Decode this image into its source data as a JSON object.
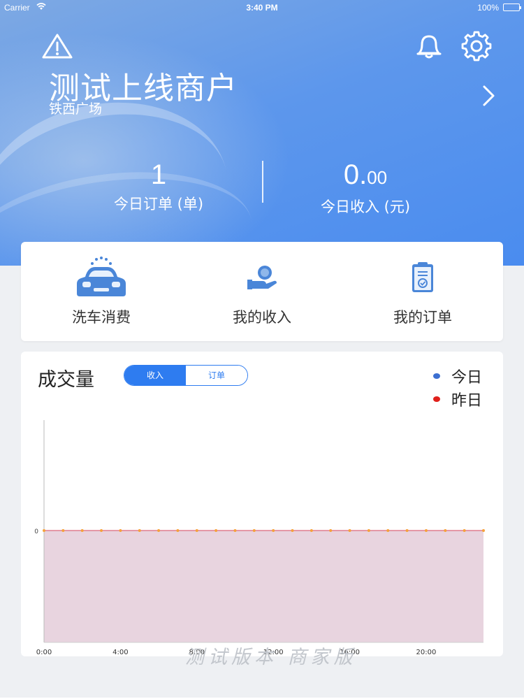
{
  "status_bar": {
    "carrier": "Carrier",
    "time": "3:40 PM",
    "battery": "100%"
  },
  "header": {
    "merchant_name": "测试上线商户",
    "location": "铁西广场",
    "icons": [
      "warning-icon",
      "bell-icon",
      "gear-icon",
      "chevron-right-icon"
    ],
    "background_color": "#4a8cef"
  },
  "stats": {
    "orders": {
      "value": "1",
      "label": "今日订单 (单)"
    },
    "income": {
      "value_int": "0.",
      "value_dec": "00",
      "label": "今日收入 (元)"
    }
  },
  "menu": {
    "items": [
      {
        "label": "洗车消费",
        "icon": "car-wash-icon"
      },
      {
        "label": "我的收入",
        "icon": "income-icon"
      },
      {
        "label": "我的订单",
        "icon": "order-clipboard-icon"
      }
    ]
  },
  "chart_card": {
    "title": "成交量",
    "tabs": [
      {
        "label": "收入",
        "active": true
      },
      {
        "label": "订单",
        "active": false
      }
    ],
    "legend": [
      {
        "label": "今日",
        "color": "#3c6fd1"
      },
      {
        "label": "昨日",
        "color": "#e0201b"
      }
    ]
  },
  "chart_data": {
    "type": "area",
    "x": [
      0,
      1,
      2,
      3,
      4,
      5,
      6,
      7,
      8,
      9,
      10,
      11,
      12,
      13,
      14,
      15,
      16,
      17,
      18,
      19,
      20,
      21,
      22,
      23
    ],
    "x_tick_labels": [
      "0:00",
      "4:00",
      "8:00",
      "12:00",
      "16:00",
      "20:00"
    ],
    "x_ticks": [
      0,
      4,
      8,
      12,
      16,
      20
    ],
    "y_tick_labels": [
      "0"
    ],
    "series": [
      {
        "name": "今日",
        "values": [
          0,
          0,
          0,
          0,
          0,
          0,
          0,
          0,
          0,
          0,
          0,
          0,
          0,
          0,
          0,
          0,
          0,
          0,
          0,
          0,
          0,
          0,
          0,
          0
        ]
      },
      {
        "name": "昨日",
        "values": [
          0,
          0,
          0,
          0,
          0,
          0,
          0,
          0,
          0,
          0,
          0,
          0,
          0,
          0,
          0,
          0,
          0,
          0,
          0,
          0,
          0,
          0,
          0,
          0
        ]
      }
    ],
    "area_color": "#e8d4df",
    "line_color": "#e07a8a",
    "marker_color": "#f5a23c",
    "legend": "top-right",
    "grid": false
  },
  "watermark": "测试版本 商家版"
}
